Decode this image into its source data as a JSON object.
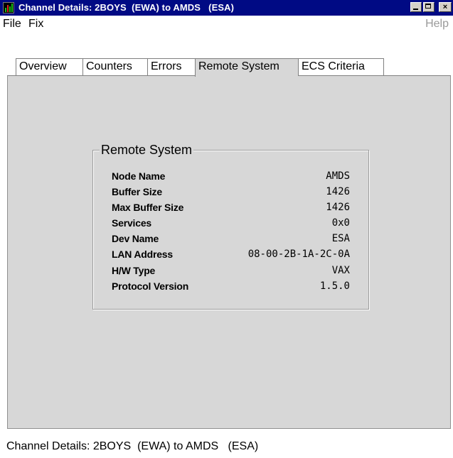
{
  "window": {
    "title": "Channel Details: 2BOYS  (EWA) to AMDS   (ESA)",
    "minimize_label": "",
    "maximize_label": "",
    "close_label": "×"
  },
  "menu": {
    "file": "File",
    "fix": "Fix",
    "help": "Help"
  },
  "tabs": [
    {
      "label": "Overview",
      "active": false
    },
    {
      "label": "Counters",
      "active": false
    },
    {
      "label": "Errors",
      "active": false
    },
    {
      "label": "Remote System",
      "active": true
    },
    {
      "label": "ECS Criteria",
      "active": false
    }
  ],
  "remote_system": {
    "title": "Remote System",
    "fields": [
      {
        "label": "Node Name",
        "value": "AMDS"
      },
      {
        "label": "Buffer Size",
        "value": "1426"
      },
      {
        "label": "Max Buffer Size",
        "value": "1426"
      },
      {
        "label": "Services",
        "value": "0x0"
      },
      {
        "label": "Dev Name",
        "value": "ESA"
      },
      {
        "label": "LAN Address",
        "value": "08-00-2B-1A-2C-0A"
      },
      {
        "label": "H/W Type",
        "value": "VAX"
      },
      {
        "label": "Protocol Version",
        "value": "1.5.0"
      }
    ]
  },
  "status": {
    "text": "Channel Details: 2BOYS  (EWA) to AMDS   (ESA)"
  },
  "colors": {
    "titlebar": "#000a84",
    "panel": "#d7d7d7",
    "window_bg": "#ffffff"
  }
}
